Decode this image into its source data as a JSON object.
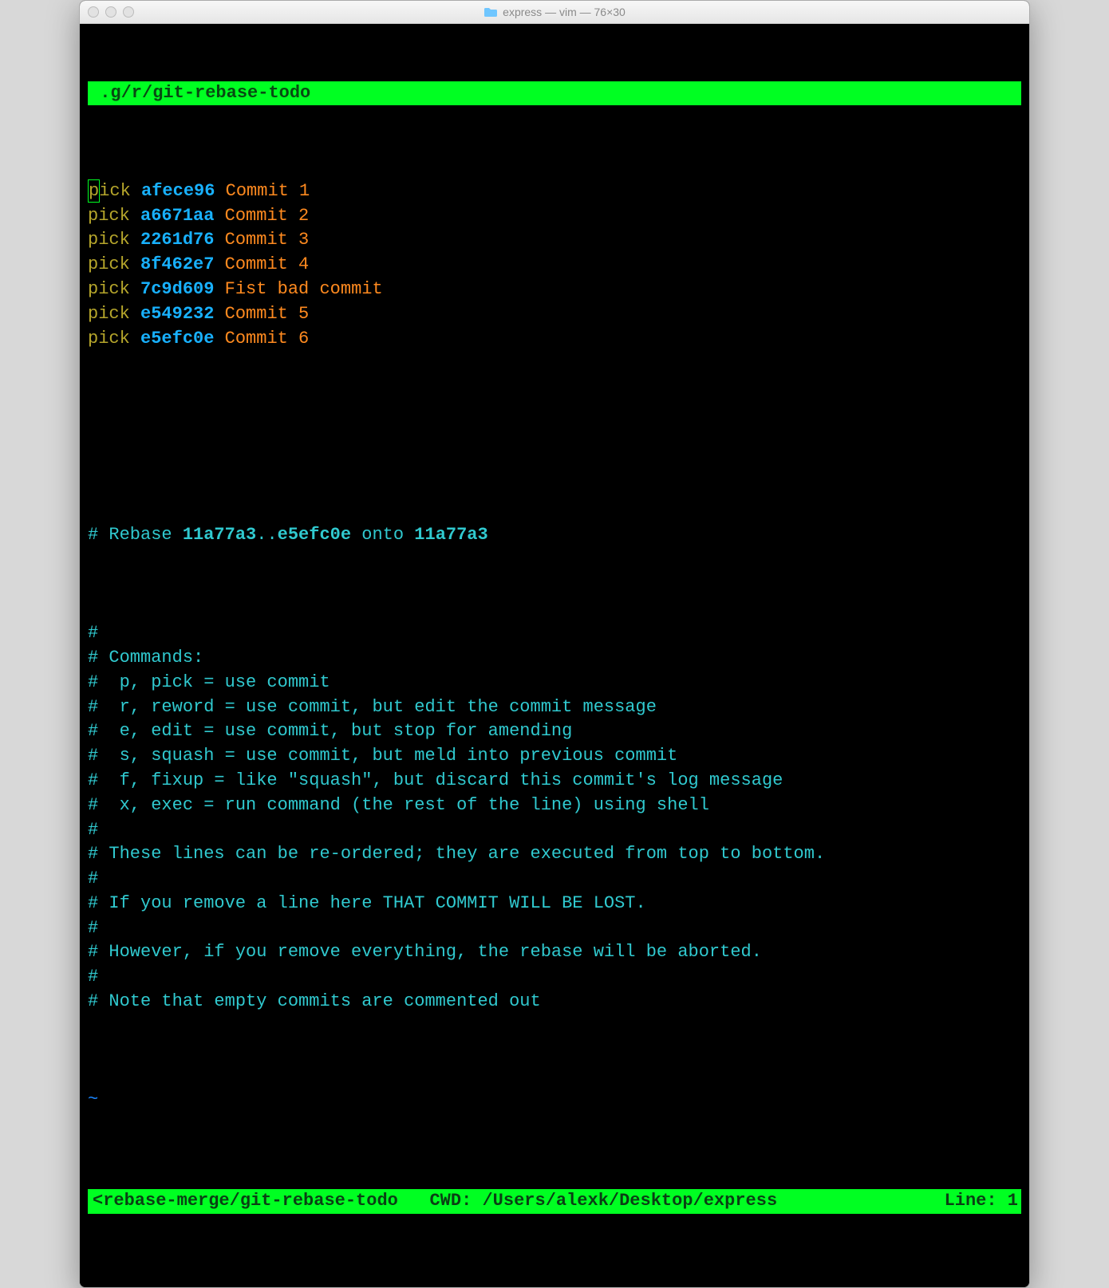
{
  "window": {
    "title": "express — vim — 76×30"
  },
  "tab": {
    "path": ".g/r/git-rebase-todo"
  },
  "commits": [
    {
      "cmd": "pick",
      "hash": "afece96",
      "msg": "Commit 1",
      "cursor": true
    },
    {
      "cmd": "pick",
      "hash": "a6671aa",
      "msg": "Commit 2"
    },
    {
      "cmd": "pick",
      "hash": "2261d76",
      "msg": "Commit 3"
    },
    {
      "cmd": "pick",
      "hash": "8f462e7",
      "msg": "Commit 4"
    },
    {
      "cmd": "pick",
      "hash": "7c9d609",
      "msg": "Fist bad commit"
    },
    {
      "cmd": "pick",
      "hash": "e549232",
      "msg": "Commit 5"
    },
    {
      "cmd": "pick",
      "hash": "e5efc0e",
      "msg": "Commit 6"
    }
  ],
  "rebase": {
    "prefix": "# Rebase ",
    "range_from": "11a77a3",
    "dots": "..",
    "range_to": "e5efc0e",
    "onto_word": " onto ",
    "onto_hash": "11a77a3"
  },
  "help": [
    "#",
    "# Commands:",
    "#  p, pick = use commit",
    "#  r, reword = use commit, but edit the commit message",
    "#  e, edit = use commit, but stop for amending",
    "#  s, squash = use commit, but meld into previous commit",
    "#  f, fixup = like \"squash\", but discard this commit's log message",
    "#  x, exec = run command (the rest of the line) using shell",
    "#",
    "# These lines can be re-ordered; they are executed from top to bottom.",
    "#",
    "# If you remove a line here THAT COMMIT WILL BE LOST.",
    "#",
    "# However, if you remove everything, the rebase will be aborted.",
    "#",
    "# Note that empty commits are commented out"
  ],
  "tilde": "~",
  "status": {
    "left": "<rebase-merge/git-rebase-todo   CWD: /Users/alexk/Desktop/express",
    "right": "Line: 1"
  }
}
